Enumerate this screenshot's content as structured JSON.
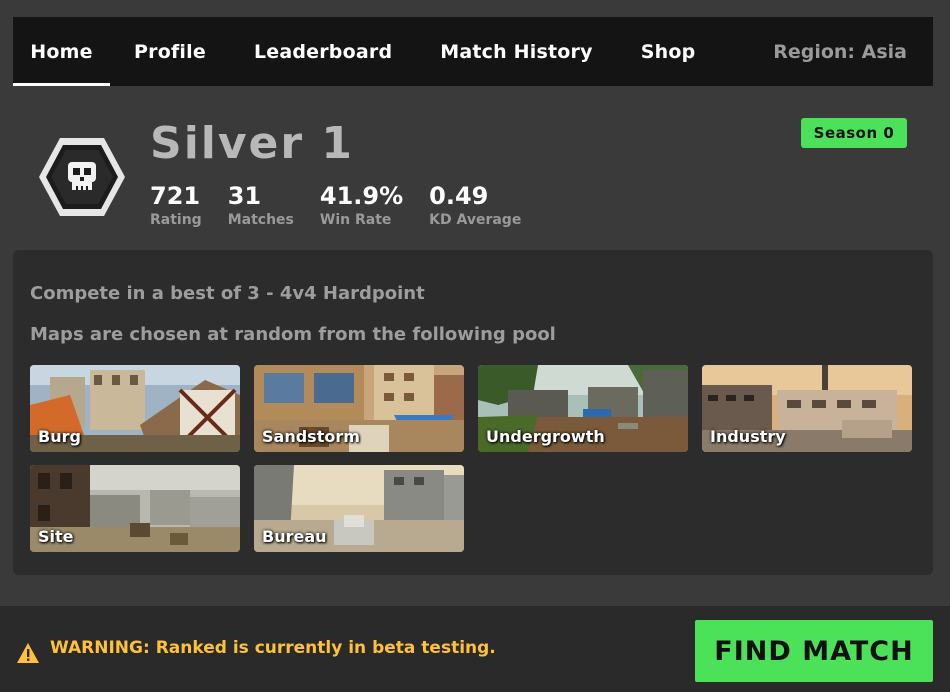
{
  "nav": {
    "items": [
      {
        "label": "Home",
        "active": true
      },
      {
        "label": "Profile"
      },
      {
        "label": "Leaderboard"
      },
      {
        "label": "Match History"
      },
      {
        "label": "Shop"
      }
    ],
    "region": "Region: Asia"
  },
  "rank": {
    "title": "Silver 1",
    "icon": "skull-icon",
    "season": "Season 0",
    "stats": [
      {
        "value": "721",
        "label": "Rating"
      },
      {
        "value": "31",
        "label": "Matches"
      },
      {
        "value": "41.9%",
        "label": "Win Rate"
      },
      {
        "value": "0.49",
        "label": "KD Average"
      }
    ]
  },
  "panel": {
    "line1": "Compete in a best of 3 - 4v4 Hardpoint",
    "line2": "Maps are chosen at random from the following pool",
    "maps": [
      {
        "name": "Burg"
      },
      {
        "name": "Sandstorm"
      },
      {
        "name": "Undergrowth"
      },
      {
        "name": "Industry"
      },
      {
        "name": "Site"
      },
      {
        "name": "Bureau"
      }
    ]
  },
  "footer": {
    "warning_prefix": "WARNING:",
    "warning_text": " Ranked is currently in beta testing.",
    "find_match": "FIND MATCH"
  },
  "colors": {
    "accent": "#4be25a",
    "warning": "#ffc13a",
    "background": "#3a3a3a",
    "panel": "#2c2c2c",
    "nav": "#141414"
  }
}
